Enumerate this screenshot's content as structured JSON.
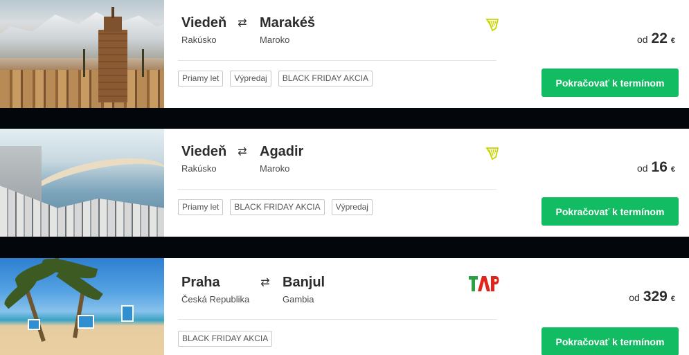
{
  "offers": [
    {
      "from_city": "Viedeň",
      "from_country": "Rakúsko",
      "to_city": "Marakéš",
      "to_country": "Maroko",
      "airline_icon": "ryanair-harp-icon",
      "tags": [
        "Priamy let",
        "Výpredaj",
        "BLACK FRIDAY AKCIA"
      ],
      "price_prefix": "od",
      "price": "22",
      "currency": "€",
      "cta": "Pokračovať k termínom"
    },
    {
      "from_city": "Viedeň",
      "from_country": "Rakúsko",
      "to_city": "Agadir",
      "to_country": "Maroko",
      "airline_icon": "ryanair-harp-icon",
      "tags": [
        "Priamy let",
        "BLACK FRIDAY AKCIA",
        "Výpredaj"
      ],
      "price_prefix": "od",
      "price": "16",
      "currency": "€",
      "cta": "Pokračovať k termínom"
    },
    {
      "from_city": "Praha",
      "from_country": "Česká Republika",
      "to_city": "Banjul",
      "to_country": "Gambia",
      "airline_icon": "tap-logo",
      "airline_logo_text": "TAP",
      "tags": [
        "BLACK FRIDAY AKCIA"
      ],
      "price_prefix": "od",
      "price": "329",
      "currency": "€",
      "cta": "Pokračovať k termínom"
    }
  ],
  "colors": {
    "cta": "#11bc62",
    "ryanair": "#c8d400",
    "tap_green": "#2aa243",
    "tap_red": "#e2251b"
  },
  "swap_icon": "⇄"
}
